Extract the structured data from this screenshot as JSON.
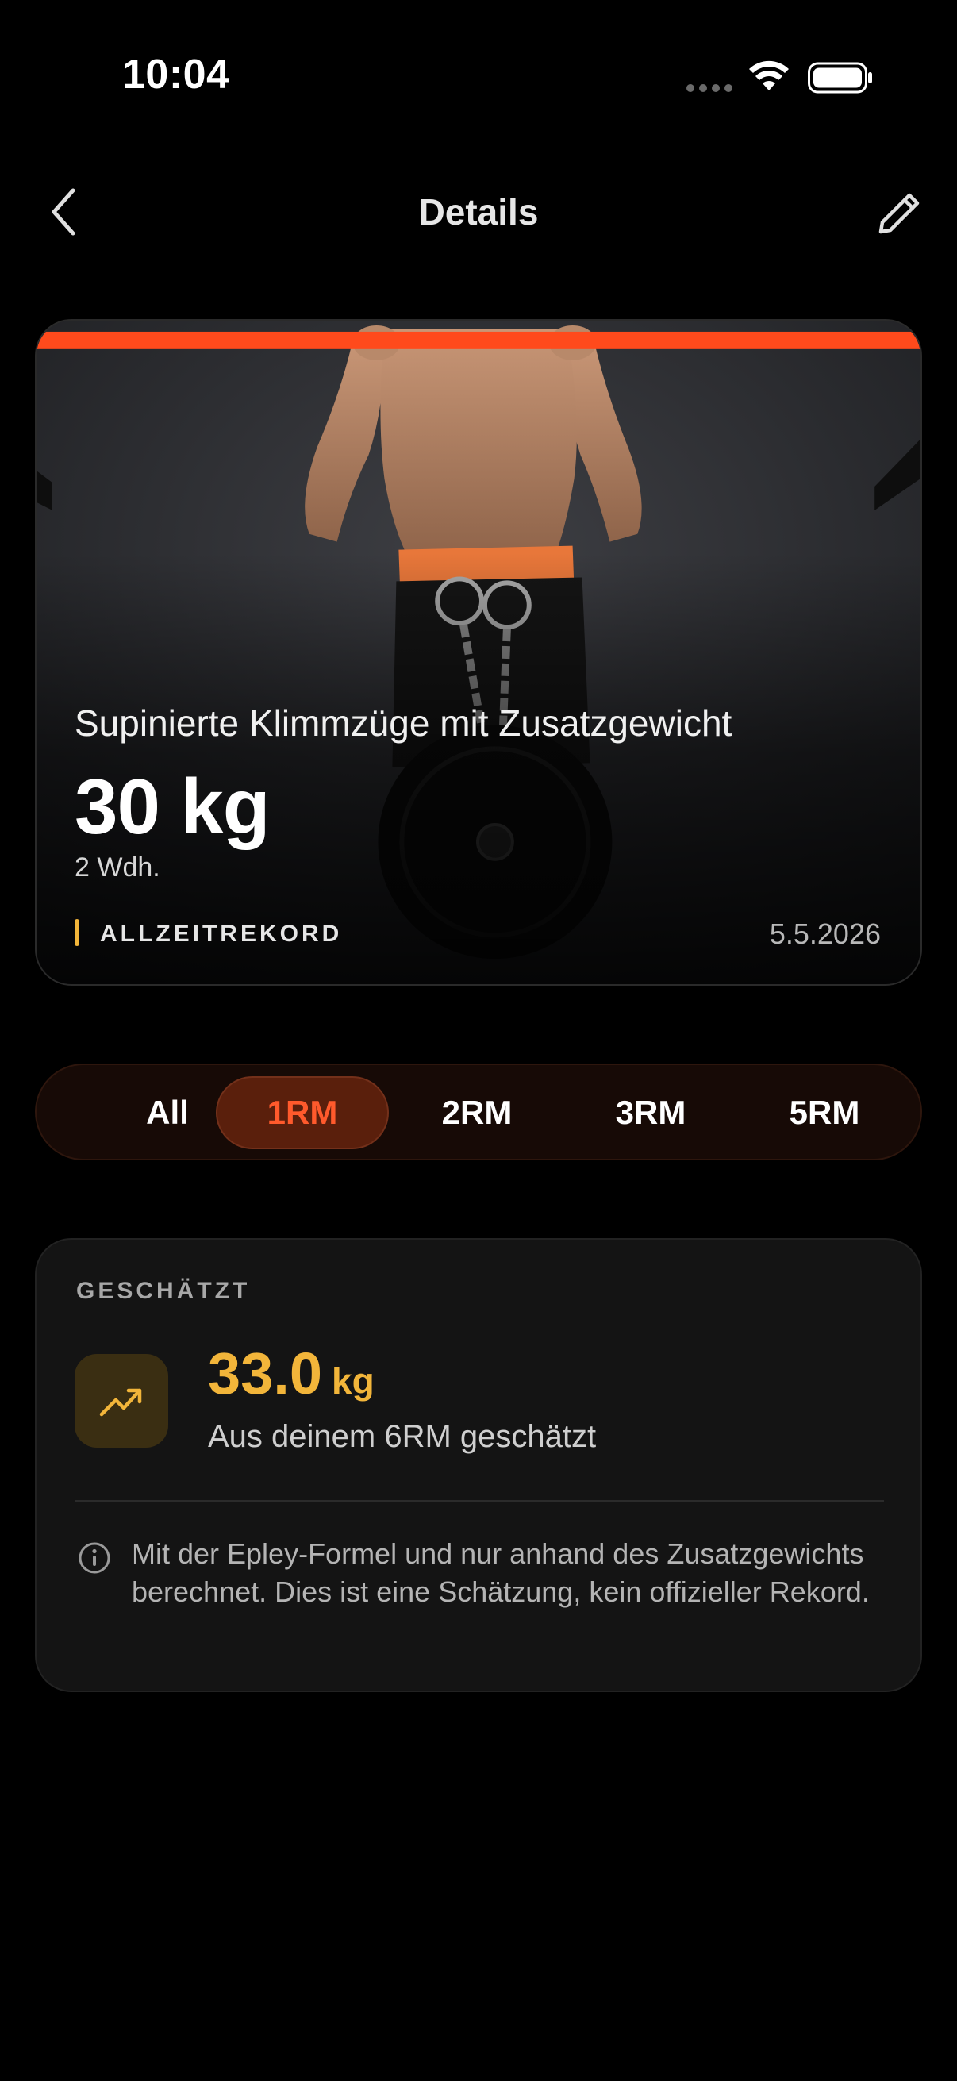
{
  "status_bar": {
    "time": "10:04"
  },
  "nav": {
    "title": "Details",
    "back_icon": "chevron-left-icon",
    "edit_icon": "pencil-icon"
  },
  "hero": {
    "exercise": "Supinierte Klimmzüge mit Zusatzgewicht",
    "weight": "30 kg",
    "reps": "2 Wdh.",
    "record_label": "ALLZEITREKORD",
    "date": "5.5.2026"
  },
  "segments": {
    "items": [
      "All",
      "1RM",
      "2RM",
      "3RM",
      "5RM"
    ],
    "selected": "1RM"
  },
  "estimate": {
    "heading": "GESCHÄTZT",
    "value": "33.0",
    "unit": "kg",
    "subtitle": "Aus deinem 6RM geschätzt",
    "note": "Mit der Epley-Formel und nur anhand des Zusatzgewichts berechnet. Dies ist eine Schätzung, kein offizieller Rekord.",
    "icon": "trending-up-icon"
  },
  "colors": {
    "accent_orange": "#ff5a2c",
    "accent_gold": "#f2b53a",
    "background": "#000000",
    "card": "#141414"
  }
}
